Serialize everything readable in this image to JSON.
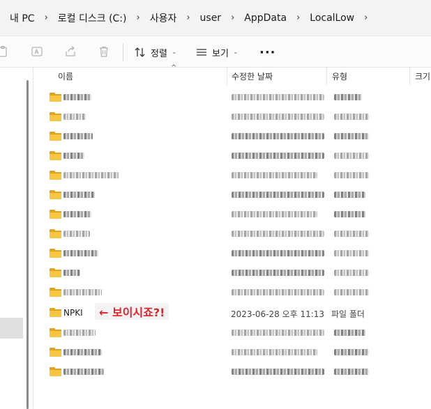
{
  "breadcrumb": {
    "items": [
      "내 PC",
      "로컬 디스크 (C:)",
      "사용자",
      "user",
      "AppData",
      "LocalLow"
    ],
    "separator": "›"
  },
  "toolbar": {
    "sort_label": "정렬",
    "view_label": "보기",
    "more_label": "···"
  },
  "columns": {
    "name": "이름",
    "date_modified": "수정한 날짜",
    "type": "유형",
    "size": "크기"
  },
  "highlighted_row": {
    "name": "NPKI",
    "date_modified": "2023-06-28 오후 11:13",
    "type": "파일 폴더",
    "annotation": "← 보이시죠?!",
    "annotation_color": "#e0202a"
  },
  "rows_obscured": [
    {
      "blurred": true
    },
    {
      "blurred": true
    },
    {
      "blurred": true
    },
    {
      "blurred": true
    },
    {
      "blurred": true
    },
    {
      "blurred": true
    },
    {
      "blurred": true
    },
    {
      "blurred": true
    },
    {
      "blurred": true
    },
    {
      "blurred": true
    },
    {
      "blurred": true
    },
    {
      "blurred": true
    },
    {
      "blurred": true
    },
    {
      "blurred": true
    }
  ],
  "colors": {
    "folder": "#f8c542",
    "folder_dark": "#e3a21a",
    "address_bar_bg": "#f3f3f3"
  }
}
